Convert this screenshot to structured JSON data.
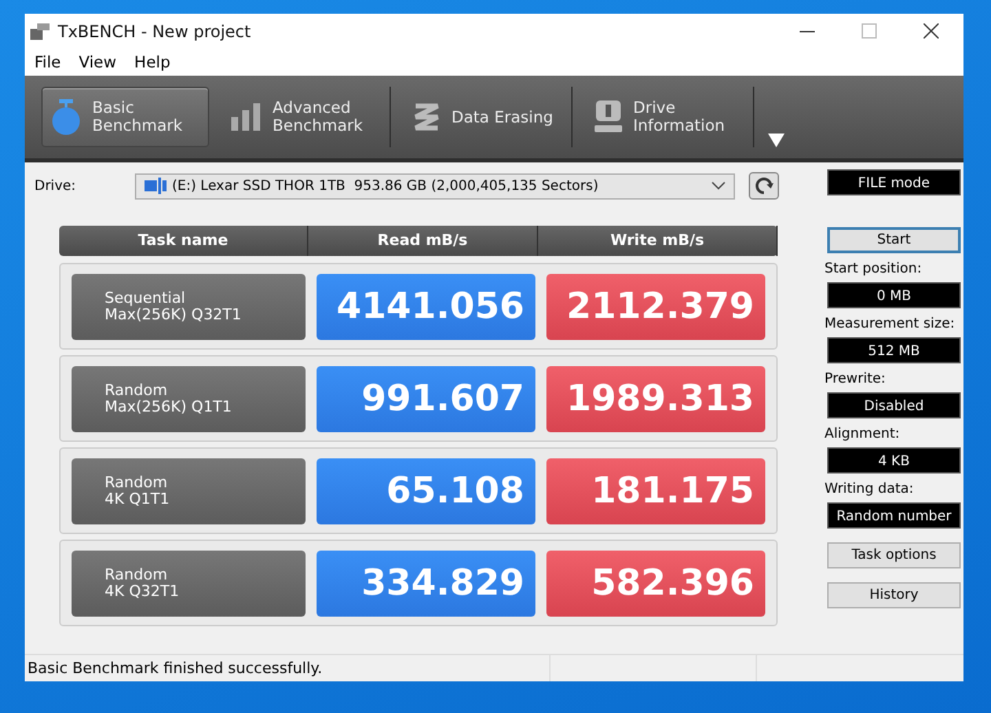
{
  "window": {
    "title": "TxBENCH - New project"
  },
  "menu": [
    "File",
    "View",
    "Help"
  ],
  "tabs": [
    {
      "label": "Basic\nBenchmark",
      "kind": "timer",
      "selected": true
    },
    {
      "label": "Advanced\nBenchmark",
      "kind": "bars",
      "selected": false
    },
    {
      "label": "Data Erasing",
      "kind": "erase",
      "selected": false
    },
    {
      "label": "Drive\nInformation",
      "kind": "drive",
      "selected": false
    }
  ],
  "drive": {
    "label": "Drive:",
    "value": "(E:) Lexar SSD THOR 1TB  953.86 GB (2,000,405,135 Sectors)"
  },
  "table": {
    "columns": [
      "Task name",
      "Read mB/s",
      "Write mB/s"
    ],
    "rows": [
      {
        "task": "Sequential\nMax(256K) Q32T1",
        "read": "4141.056",
        "write": "2112.379"
      },
      {
        "task": "Random\nMax(256K) Q1T1",
        "read": "991.607",
        "write": "1989.313"
      },
      {
        "task": "Random\n4K Q1T1",
        "read": "65.108",
        "write": "181.175"
      },
      {
        "task": "Random\n4K Q32T1",
        "read": "334.829",
        "write": "582.396"
      }
    ]
  },
  "mode": "FILE mode",
  "start_button": "Start",
  "settings": [
    {
      "label": "Start position:",
      "value": "0 MB"
    },
    {
      "label": "Measurement size:",
      "value": "512 MB"
    },
    {
      "label": "Prewrite:",
      "value": "Disabled"
    },
    {
      "label": "Alignment:",
      "value": "4 KB"
    },
    {
      "label": "Writing data:",
      "value": "Random number"
    }
  ],
  "buttons": [
    "Task options",
    "History"
  ],
  "status_bar": "Basic Benchmark finished successfully."
}
